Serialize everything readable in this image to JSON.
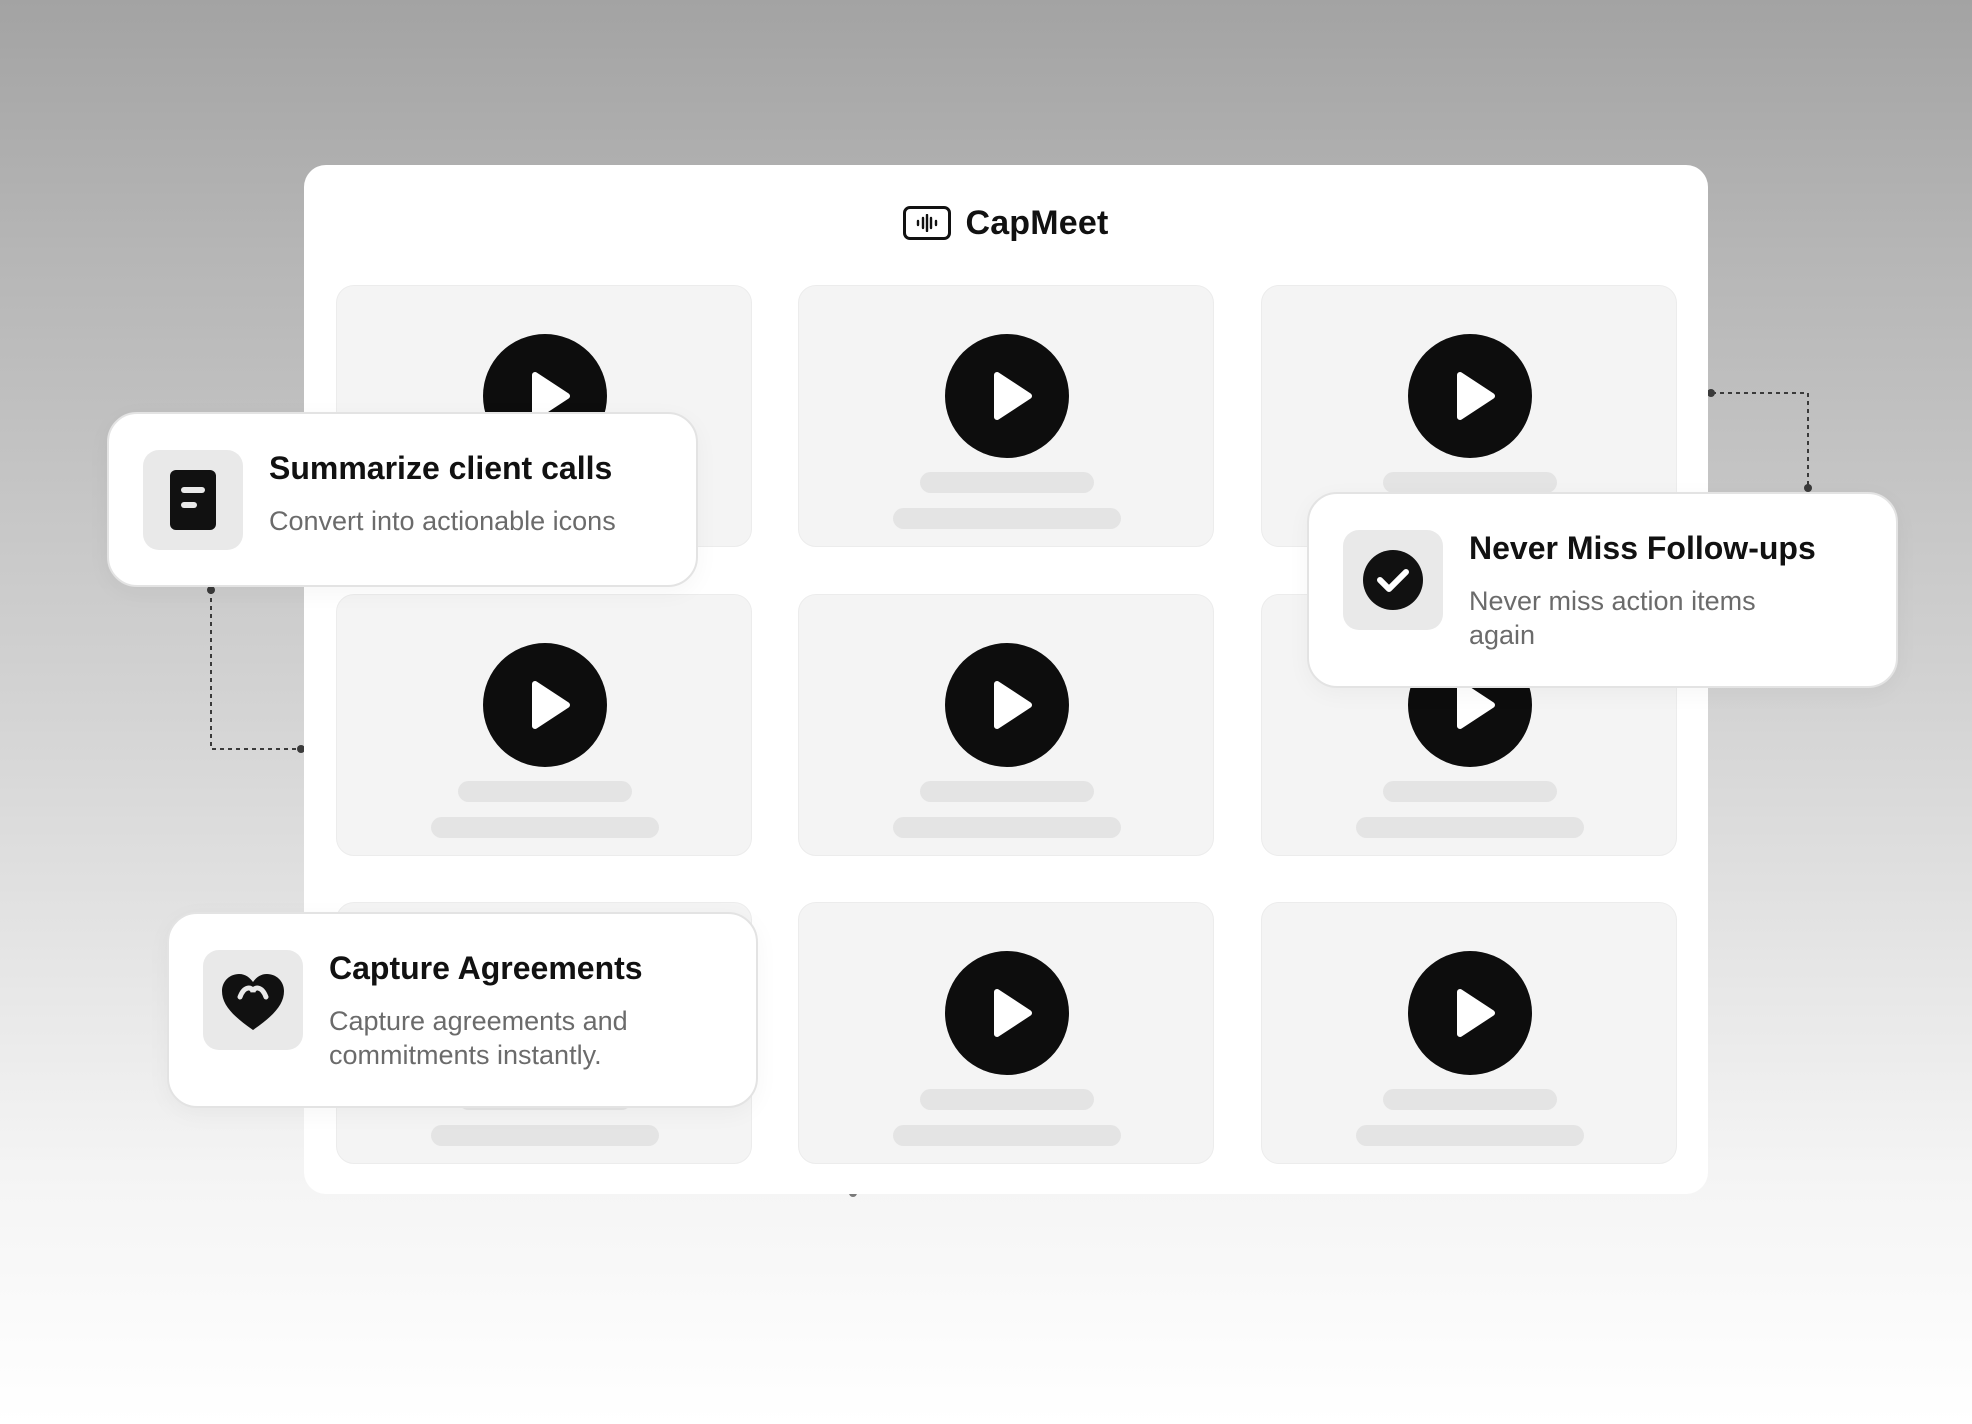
{
  "brand": {
    "name": "CapMeet",
    "logo_icon": "waveform-icon"
  },
  "video_grid": {
    "tile_count": 9,
    "play_icon": "play-icon",
    "colors": {
      "tile_bg": "#f4f4f4",
      "placeholder": "#e4e4e4",
      "play_bg": "#0d0d0d"
    }
  },
  "features": [
    {
      "icon": "document-icon",
      "title": "Summarize client calls",
      "description": "Convert into actionable icons"
    },
    {
      "icon": "check-circle-icon",
      "title": "Never Miss Follow-ups",
      "description": "Never miss action items again"
    },
    {
      "icon": "heart-icon",
      "title": "Capture Agreements",
      "description": "Capture agreements and commitments instantly."
    }
  ],
  "colors": {
    "accent": "#111111",
    "muted_text": "#6b6b6b",
    "icon_tile": "#e9e9e9",
    "card_border": "#e3e3e3"
  }
}
